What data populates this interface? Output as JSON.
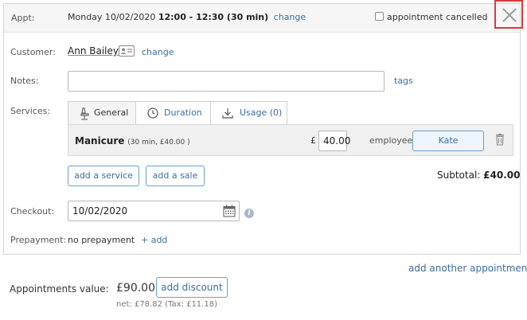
{
  "header": {
    "appt_label": "Appt:",
    "date": "Monday 10/02/2020",
    "time": "12:00 - 12:30 (30 min)",
    "change_label": "change",
    "cancelled_label": "appointment cancelled"
  },
  "customer": {
    "label": "Customer:",
    "name": "Ann Bailey",
    "change_label": "change"
  },
  "notes": {
    "label": "Notes:",
    "value": "",
    "tags_label": "tags"
  },
  "services": {
    "label": "Services:",
    "tabs": [
      {
        "label": "General",
        "icon": "chair-icon",
        "active": true
      },
      {
        "label": "Duration",
        "icon": "clock-icon",
        "active": false
      },
      {
        "label": "Usage (0)",
        "icon": "download-icon",
        "active": false
      }
    ],
    "item": {
      "name": "Manicure",
      "details": "(30 min, £40.00 )",
      "currency": "£",
      "price": "40.00",
      "employee_label": "employee:",
      "employee": "Kate"
    },
    "add_service_label": "add a service",
    "add_sale_label": "add a sale",
    "subtotal_label": "Subtotal:",
    "subtotal_value": "£40.00"
  },
  "checkout": {
    "label": "Checkout:",
    "date": "10/02/2020"
  },
  "prepayment": {
    "label": "Prepayment:",
    "value": "no prepayment",
    "add_label": "+ add"
  },
  "footer": {
    "add_another_label": "add another appointment",
    "value_label": "Appointments value:",
    "value": "£90.00",
    "discount_label": "add discount",
    "net_text": "net: £78.82 (Tax: £11.18)"
  },
  "colors": {
    "link": "#3a6ea5",
    "close_highlight": "#d83a3a",
    "panel_border": "#d6d6d6"
  }
}
